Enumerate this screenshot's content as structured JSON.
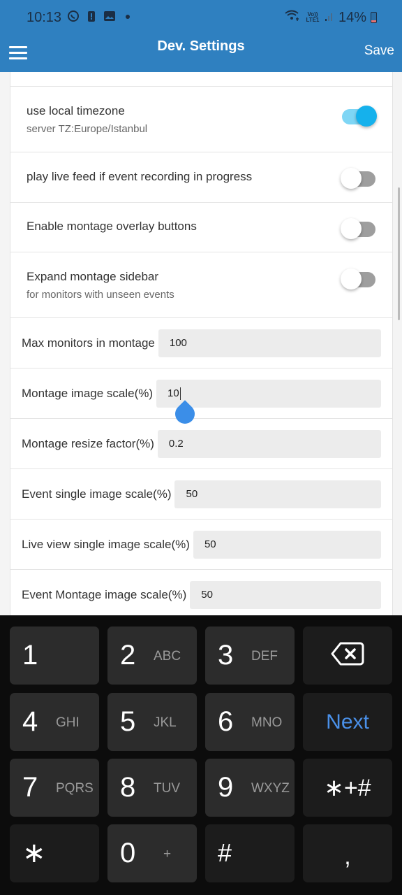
{
  "status_bar": {
    "time": "10:13",
    "left_icons": [
      "whatsapp-icon",
      "battery-alert-icon",
      "gallery-icon",
      "dot-icon"
    ],
    "network": "Vo)) LTE1",
    "battery_percent": "14%"
  },
  "app_bar": {
    "title": "Dev. Settings",
    "save_label": "Save",
    "menu_icon": "hamburger-menu-icon"
  },
  "toggles": [
    {
      "label": "use local timezone",
      "sub": "server TZ:Europe/Istanbul",
      "on": true
    },
    {
      "label": "play live feed if event recording in progress",
      "sub": "",
      "on": false
    },
    {
      "label": "Enable montage overlay buttons",
      "sub": "",
      "on": false
    },
    {
      "label": "Expand montage sidebar",
      "sub": "for monitors with unseen events",
      "on": false
    }
  ],
  "inputs": [
    {
      "label": "Max monitors in montage",
      "value": "100"
    },
    {
      "label": "Montage image scale(%)",
      "value": "10",
      "focused": true
    },
    {
      "label": "Montage resize factor(%)",
      "value": "0.2"
    },
    {
      "label": "Event single image scale(%)",
      "value": "50"
    },
    {
      "label": "Live view single image scale(%)",
      "value": "50"
    },
    {
      "label": "Event Montage image scale(%)",
      "value": "50"
    }
  ],
  "keyboard": {
    "keys": [
      {
        "num": "1",
        "letters": ""
      },
      {
        "num": "2",
        "letters": "ABC"
      },
      {
        "num": "3",
        "letters": "DEF"
      },
      {
        "num": "4",
        "letters": "GHI"
      },
      {
        "num": "5",
        "letters": "JKL"
      },
      {
        "num": "6",
        "letters": "MNO"
      },
      {
        "num": "7",
        "letters": "PQRS"
      },
      {
        "num": "8",
        "letters": "TUV"
      },
      {
        "num": "9",
        "letters": "WXYZ"
      },
      {
        "num": "0",
        "letters": "+"
      }
    ],
    "backspace_icon": "backspace-icon",
    "next_label": "Next",
    "symbols_label": "∗+#",
    "star_label": "∗",
    "hash_label": "#",
    "comma_label": ","
  },
  "colors": {
    "primary": "#2f80c0",
    "toggle_on": "#15b1ec",
    "next_blue": "#4a90e8"
  }
}
